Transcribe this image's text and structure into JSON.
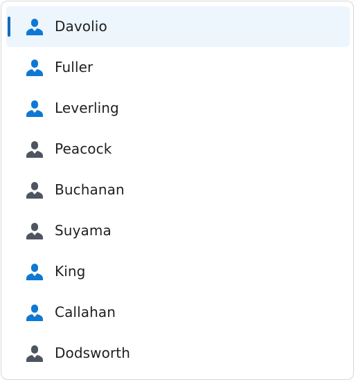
{
  "colors": {
    "selected_bg": "#edf5fd",
    "selected_indicator": "#0f6cbd",
    "icon_blue": "#0f78d4",
    "icon_gray": "#4e5560",
    "text": "#1f1f1f",
    "border": "#d6d6d6"
  },
  "list": {
    "items": [
      {
        "label": "Davolio",
        "icon": "person-icon",
        "icon_color": "#0f78d4",
        "selected": true
      },
      {
        "label": "Fuller",
        "icon": "person-icon",
        "icon_color": "#0f78d4",
        "selected": false
      },
      {
        "label": "Leverling",
        "icon": "person-icon",
        "icon_color": "#0f78d4",
        "selected": false
      },
      {
        "label": "Peacock",
        "icon": "person-icon",
        "icon_color": "#4e5560",
        "selected": false
      },
      {
        "label": "Buchanan",
        "icon": "person-icon",
        "icon_color": "#4e5560",
        "selected": false
      },
      {
        "label": "Suyama",
        "icon": "person-icon",
        "icon_color": "#4e5560",
        "selected": false
      },
      {
        "label": "King",
        "icon": "person-icon",
        "icon_color": "#0f78d4",
        "selected": false
      },
      {
        "label": "Callahan",
        "icon": "person-icon",
        "icon_color": "#0f78d4",
        "selected": false
      },
      {
        "label": "Dodsworth",
        "icon": "person-icon",
        "icon_color": "#4e5560",
        "selected": false
      }
    ]
  }
}
